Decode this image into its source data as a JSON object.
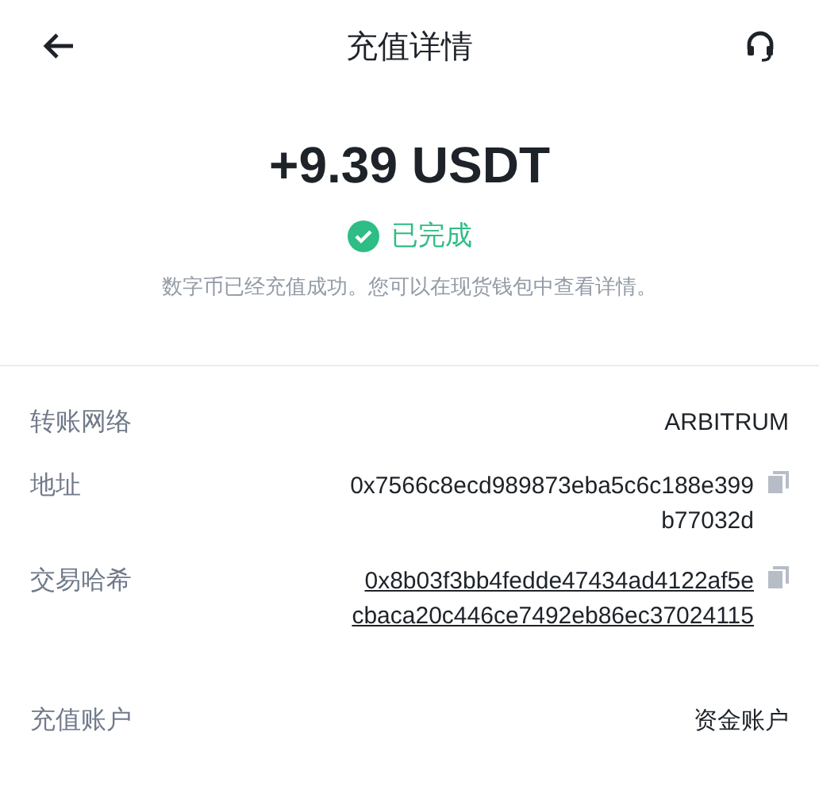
{
  "header": {
    "title": "充值详情"
  },
  "amount": "+9.39 USDT",
  "status": {
    "label": "已完成",
    "completed": true
  },
  "description": "数字币已经充值成功。您可以在现货钱包中查看详情。",
  "details": [
    {
      "kind": "text",
      "label": "转账网络",
      "lines": [
        "ARBITRUM"
      ]
    },
    {
      "kind": "copy",
      "label": "地址",
      "lines": [
        "0x7566c8ecd989873eba5c6c188e399",
        "b77032d"
      ]
    },
    {
      "kind": "copylink",
      "label": "交易哈希",
      "lines": [
        "0x8b03f3bb4fedde47434ad4122af5e",
        "cbaca20c446ce7492eb86ec37024115"
      ]
    },
    {
      "kind": "text",
      "label": "充值账户",
      "lines": [
        "资金账户"
      ]
    }
  ]
}
